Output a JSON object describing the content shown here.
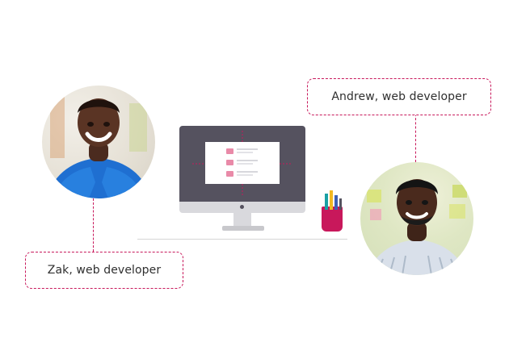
{
  "people": {
    "zak": {
      "label": "Zak, web developer"
    },
    "andrew": {
      "label": "Andrew, web developer"
    }
  },
  "colors": {
    "accent": "#c8185b",
    "monitor": "#55525f",
    "monitor_light": "#d9d9dd",
    "pen_teal": "#1aa0a4",
    "pen_yellow": "#f2b823",
    "pen_blue": "#3e5fb3"
  },
  "icons": {
    "monitor": "desktop-monitor-icon",
    "pen_cup": "pen-cup-icon"
  }
}
